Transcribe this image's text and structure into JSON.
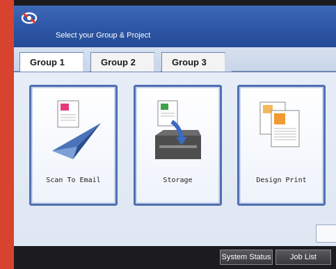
{
  "header": {
    "title": "Select your Group & Project",
    "logo_icon": "ricoh-logo-icon"
  },
  "tabs": [
    {
      "label": "Group 1",
      "active": true
    },
    {
      "label": "Group 2",
      "active": false
    },
    {
      "label": "Group 3",
      "active": false
    }
  ],
  "cards": [
    {
      "label": "Scan To Email",
      "icon": "paper-plane-document-icon"
    },
    {
      "label": "Storage",
      "icon": "document-storage-tray-icon"
    },
    {
      "label": "Design Print",
      "icon": "stacked-documents-icon"
    }
  ],
  "bottom": {
    "system_status": "System Status",
    "job_list": "Job List"
  },
  "colors": {
    "header_blue": "#2d56a4",
    "card_border": "#4f6fb0",
    "side_strip": "#d8432f",
    "bottom_bar": "#1c1c1e"
  }
}
